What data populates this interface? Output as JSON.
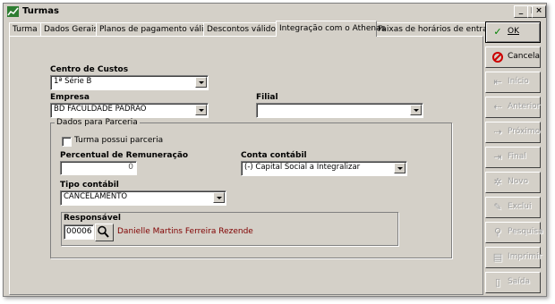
{
  "window": {
    "title": "Turmas",
    "minimize": "_",
    "maximize": "□",
    "close": "×"
  },
  "tabs": [
    {
      "label": "Turma"
    },
    {
      "label": "Dados Gerais"
    },
    {
      "label": "Planos de pagamento válidos"
    },
    {
      "label": "Descontos válidos"
    },
    {
      "label": "Integração com o Athenas"
    },
    {
      "label": "Faixas de horários de entrada"
    }
  ],
  "form": {
    "centro_custos": {
      "label": "Centro de Custos",
      "value": "1ª Série B"
    },
    "empresa": {
      "label": "Empresa",
      "value": "BD FACULDADE PADRAO"
    },
    "filial": {
      "label": "Filial",
      "value": ""
    },
    "parceria": {
      "group_label": "Dados para Parceria",
      "checkbox_label": "Turma possui parceria",
      "checked": false,
      "percentual": {
        "label": "Percentual de Remuneração",
        "value": "0"
      },
      "conta_contabil": {
        "label": "Conta contábil",
        "value": "(-) Capital Social a Integralizar"
      },
      "tipo_contabil": {
        "label": "Tipo contábil",
        "value": "CANCELAMENTO"
      },
      "responsavel": {
        "label": "Responsável",
        "code": "00006",
        "name": "Danielle Martins Ferreira Rezende"
      }
    }
  },
  "side_buttons": [
    {
      "label": "OK",
      "icon": "check-icon"
    },
    {
      "label": "Cancela",
      "icon": "cancel-icon"
    },
    {
      "label": "Início",
      "icon": "first-icon"
    },
    {
      "label": "Anterior",
      "icon": "prev-icon"
    },
    {
      "label": "Próximo",
      "icon": "next-icon"
    },
    {
      "label": "Final",
      "icon": "last-icon"
    },
    {
      "label": "Novo",
      "icon": "new-icon"
    },
    {
      "label": "Exclui",
      "icon": "delete-icon"
    },
    {
      "label": "Pesquisa",
      "icon": "search-icon"
    },
    {
      "label": "Imprimir",
      "icon": "print-icon"
    },
    {
      "label": "Saída",
      "icon": "exit-icon"
    }
  ],
  "colors": {
    "responsavel_name": "#800000",
    "ok_check": "#008000",
    "cancel_icon": "#cc0000"
  }
}
